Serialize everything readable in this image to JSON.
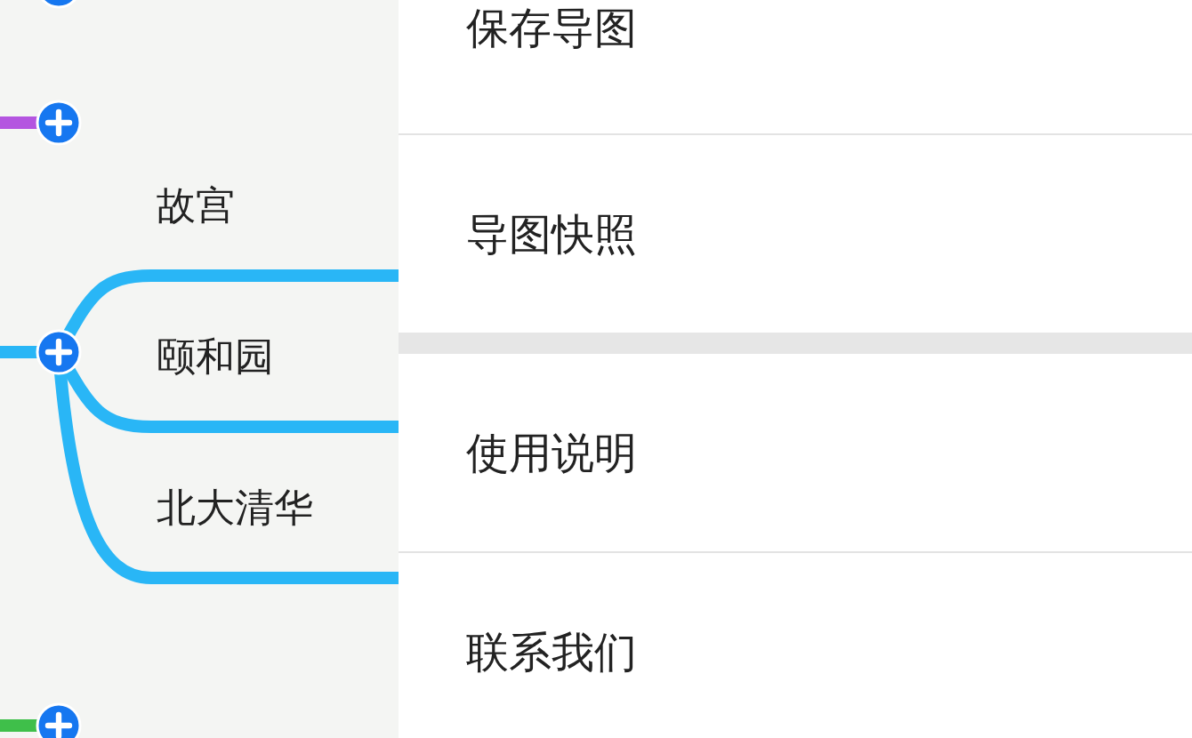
{
  "mind_map": {
    "branches": [
      {
        "kind": "node"
      },
      {
        "kind": "node",
        "color": "#b455e0"
      },
      {
        "kind": "node",
        "color": "#29b6f6",
        "children": [
          {
            "label": "故宫"
          },
          {
            "label": "颐和园"
          },
          {
            "label": "北大清华"
          }
        ]
      },
      {
        "kind": "node",
        "color": "#3fbf4a"
      }
    ]
  },
  "menu": {
    "sections": [
      {
        "items": [
          {
            "label": "保存导图"
          },
          {
            "label": "导图快照"
          }
        ]
      },
      {
        "items": [
          {
            "label": "使用说明"
          },
          {
            "label": "联系我们"
          }
        ]
      }
    ]
  }
}
